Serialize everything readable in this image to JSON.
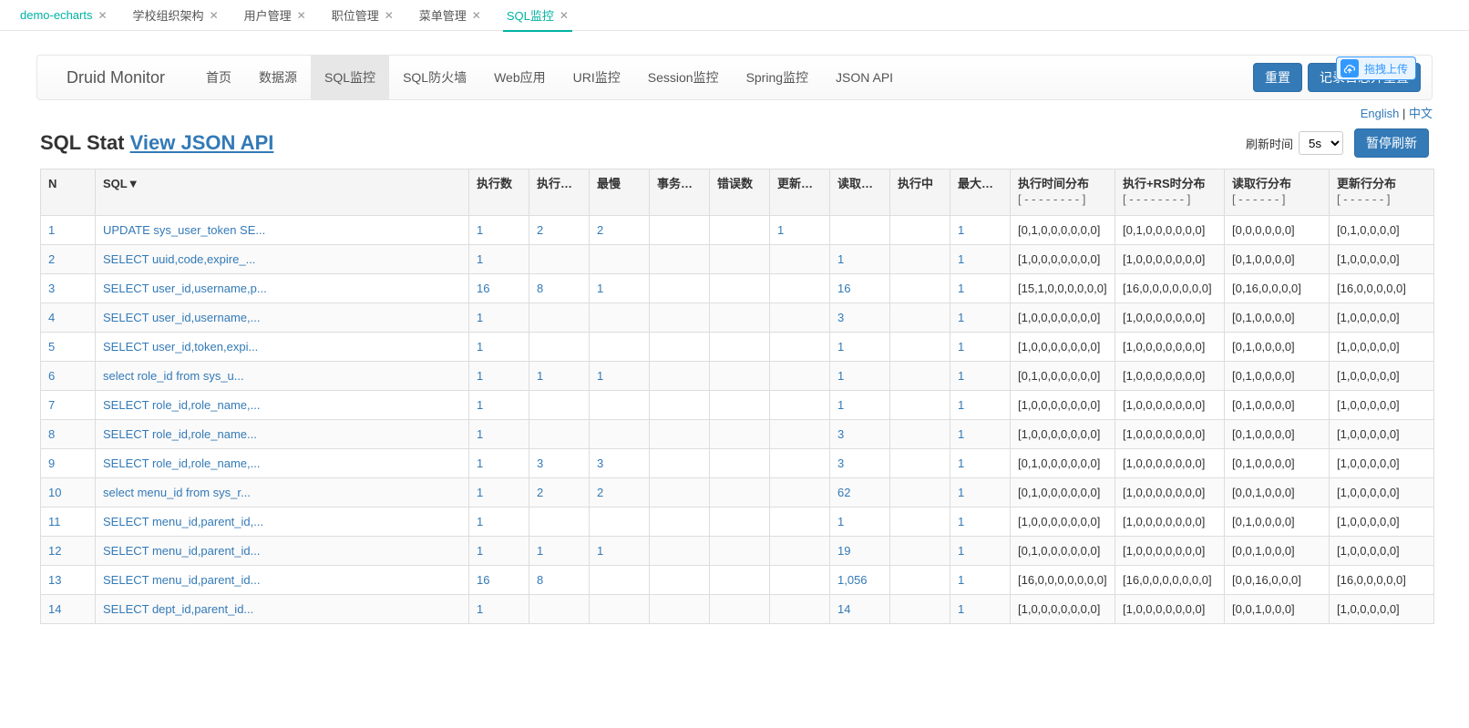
{
  "tabs": [
    {
      "label": "demo-echarts",
      "active": false,
      "first": true
    },
    {
      "label": "学校组织架构",
      "active": false
    },
    {
      "label": "用户管理",
      "active": false
    },
    {
      "label": "职位管理",
      "active": false
    },
    {
      "label": "菜单管理",
      "active": false
    },
    {
      "label": "SQL监控",
      "active": true
    }
  ],
  "upload_label": "拖拽上传",
  "brand": "Druid Monitor",
  "nav": [
    {
      "label": "首页"
    },
    {
      "label": "数据源"
    },
    {
      "label": "SQL监控",
      "active": true
    },
    {
      "label": "SQL防火墙"
    },
    {
      "label": "Web应用"
    },
    {
      "label": "URI监控"
    },
    {
      "label": "Session监控"
    },
    {
      "label": "Spring监控"
    },
    {
      "label": "JSON API"
    }
  ],
  "nav_buttons": {
    "reset": "重置",
    "logreset": "记录日志并重置"
  },
  "lang": {
    "en": "English",
    "sep": " | ",
    "cn": "中文"
  },
  "title_plain": "SQL Stat ",
  "title_api": "View JSON API",
  "refresh_label": "刷新时间",
  "refresh_opts": [
    "5s"
  ],
  "pause_label": "暂停刷新",
  "headers": {
    "n": "N",
    "sql": "SQL▼",
    "exec": "执行数",
    "exec_t": "执行时间",
    "slow": "最慢",
    "tx": "事务执行",
    "err": "错误数",
    "upd": "更新行数",
    "read": "读取行数",
    "running": "执行中",
    "maxc": "最大并发",
    "dist_exec": "执行时间分布",
    "dist_rs": "执行+RS时分布",
    "dist_read": "读取行分布",
    "dist_upd": "更新行分布",
    "dash8": "[ - - - - - - - - ]",
    "dash6": "[ - - - - - - ]"
  },
  "rows": [
    {
      "n": "1",
      "sql": "UPDATE sys_user_token SE...",
      "exec": "1",
      "exec_t": "2",
      "slow": "2",
      "tx": "",
      "err": "",
      "upd": "1",
      "read": "",
      "running": "",
      "maxc": "1",
      "d1": "[0,1,0,0,0,0,0,0]",
      "d2": "[0,1,0,0,0,0,0,0]",
      "d3": "[0,0,0,0,0,0]",
      "d4": "[0,1,0,0,0,0]"
    },
    {
      "n": "2",
      "sql": "SELECT uuid,code,expire_...",
      "exec": "1",
      "exec_t": "",
      "slow": "",
      "tx": "",
      "err": "",
      "upd": "",
      "read": "1",
      "running": "",
      "maxc": "1",
      "d1": "[1,0,0,0,0,0,0,0]",
      "d2": "[1,0,0,0,0,0,0,0]",
      "d3": "[0,1,0,0,0,0]",
      "d4": "[1,0,0,0,0,0]"
    },
    {
      "n": "3",
      "sql": "SELECT user_id,username,p...",
      "exec": "16",
      "exec_t": "8",
      "slow": "1",
      "tx": "",
      "err": "",
      "upd": "",
      "read": "16",
      "running": "",
      "maxc": "1",
      "d1": "[15,1,0,0,0,0,0,0]",
      "d2": "[16,0,0,0,0,0,0,0]",
      "d3": "[0,16,0,0,0,0]",
      "d4": "[16,0,0,0,0,0]"
    },
    {
      "n": "4",
      "sql": "SELECT user_id,username,...",
      "exec": "1",
      "exec_t": "",
      "slow": "",
      "tx": "",
      "err": "",
      "upd": "",
      "read": "3",
      "running": "",
      "maxc": "1",
      "d1": "[1,0,0,0,0,0,0,0]",
      "d2": "[1,0,0,0,0,0,0,0]",
      "d3": "[0,1,0,0,0,0]",
      "d4": "[1,0,0,0,0,0]"
    },
    {
      "n": "5",
      "sql": "SELECT user_id,token,expi...",
      "exec": "1",
      "exec_t": "",
      "slow": "",
      "tx": "",
      "err": "",
      "upd": "",
      "read": "1",
      "running": "",
      "maxc": "1",
      "d1": "[1,0,0,0,0,0,0,0]",
      "d2": "[1,0,0,0,0,0,0,0]",
      "d3": "[0,1,0,0,0,0]",
      "d4": "[1,0,0,0,0,0]"
    },
    {
      "n": "6",
      "sql": "select role_id from sys_u...",
      "exec": "1",
      "exec_t": "1",
      "slow": "1",
      "tx": "",
      "err": "",
      "upd": "",
      "read": "1",
      "running": "",
      "maxc": "1",
      "d1": "[0,1,0,0,0,0,0,0]",
      "d2": "[1,0,0,0,0,0,0,0]",
      "d3": "[0,1,0,0,0,0]",
      "d4": "[1,0,0,0,0,0]"
    },
    {
      "n": "7",
      "sql": "SELECT role_id,role_name,...",
      "exec": "1",
      "exec_t": "",
      "slow": "",
      "tx": "",
      "err": "",
      "upd": "",
      "read": "1",
      "running": "",
      "maxc": "1",
      "d1": "[1,0,0,0,0,0,0,0]",
      "d2": "[1,0,0,0,0,0,0,0]",
      "d3": "[0,1,0,0,0,0]",
      "d4": "[1,0,0,0,0,0]"
    },
    {
      "n": "8",
      "sql": "SELECT role_id,role_name...",
      "exec": "1",
      "exec_t": "",
      "slow": "",
      "tx": "",
      "err": "",
      "upd": "",
      "read": "3",
      "running": "",
      "maxc": "1",
      "d1": "[1,0,0,0,0,0,0,0]",
      "d2": "[1,0,0,0,0,0,0,0]",
      "d3": "[0,1,0,0,0,0]",
      "d4": "[1,0,0,0,0,0]"
    },
    {
      "n": "9",
      "sql": "SELECT role_id,role_name,...",
      "exec": "1",
      "exec_t": "3",
      "slow": "3",
      "tx": "",
      "err": "",
      "upd": "",
      "read": "3",
      "running": "",
      "maxc": "1",
      "d1": "[0,1,0,0,0,0,0,0]",
      "d2": "[1,0,0,0,0,0,0,0]",
      "d3": "[0,1,0,0,0,0]",
      "d4": "[1,0,0,0,0,0]"
    },
    {
      "n": "10",
      "sql": "select menu_id from sys_r...",
      "exec": "1",
      "exec_t": "2",
      "slow": "2",
      "tx": "",
      "err": "",
      "upd": "",
      "read": "62",
      "running": "",
      "maxc": "1",
      "d1": "[0,1,0,0,0,0,0,0]",
      "d2": "[1,0,0,0,0,0,0,0]",
      "d3": "[0,0,1,0,0,0]",
      "d4": "[1,0,0,0,0,0]"
    },
    {
      "n": "11",
      "sql": "SELECT menu_id,parent_id,...",
      "exec": "1",
      "exec_t": "",
      "slow": "",
      "tx": "",
      "err": "",
      "upd": "",
      "read": "1",
      "running": "",
      "maxc": "1",
      "d1": "[1,0,0,0,0,0,0,0]",
      "d2": "[1,0,0,0,0,0,0,0]",
      "d3": "[0,1,0,0,0,0]",
      "d4": "[1,0,0,0,0,0]"
    },
    {
      "n": "12",
      "sql": "SELECT menu_id,parent_id...",
      "exec": "1",
      "exec_t": "1",
      "slow": "1",
      "tx": "",
      "err": "",
      "upd": "",
      "read": "19",
      "running": "",
      "maxc": "1",
      "d1": "[0,1,0,0,0,0,0,0]",
      "d2": "[1,0,0,0,0,0,0,0]",
      "d3": "[0,0,1,0,0,0]",
      "d4": "[1,0,0,0,0,0]"
    },
    {
      "n": "13",
      "sql": "SELECT menu_id,parent_id...",
      "exec": "16",
      "exec_t": "8",
      "slow": "",
      "tx": "",
      "err": "",
      "upd": "",
      "read": "1,056",
      "running": "",
      "maxc": "1",
      "d1": "[16,0,0,0,0,0,0,0]",
      "d2": "[16,0,0,0,0,0,0,0]",
      "d3": "[0,0,16,0,0,0]",
      "d4": "[16,0,0,0,0,0]"
    },
    {
      "n": "14",
      "sql": "SELECT dept_id,parent_id...",
      "exec": "1",
      "exec_t": "",
      "slow": "",
      "tx": "",
      "err": "",
      "upd": "",
      "read": "14",
      "running": "",
      "maxc": "1",
      "d1": "[1,0,0,0,0,0,0,0]",
      "d2": "[1,0,0,0,0,0,0,0]",
      "d3": "[0,0,1,0,0,0]",
      "d4": "[1,0,0,0,0,0]"
    }
  ]
}
